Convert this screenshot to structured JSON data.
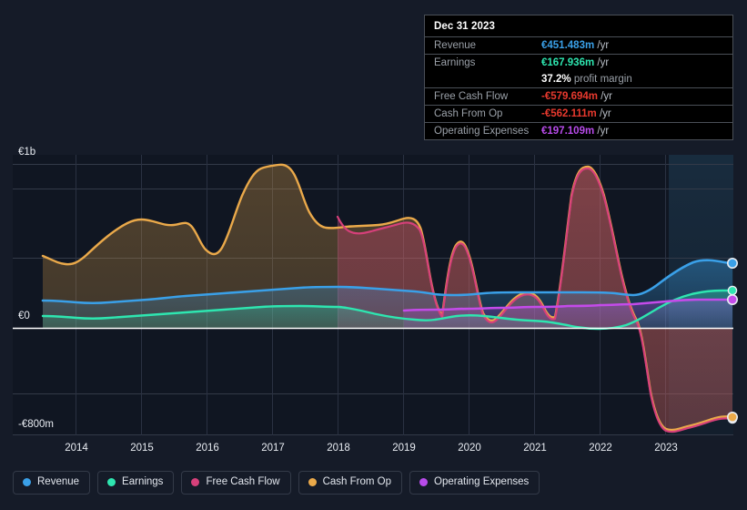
{
  "tooltip": {
    "title": "Dec 31 2023",
    "rows": [
      {
        "label": "Revenue",
        "value": "€451.483m",
        "unit": "/yr",
        "color": "#3aa0e8"
      },
      {
        "label": "Earnings",
        "value": "€167.936m",
        "unit": "/yr",
        "color": "#2ee6b0"
      },
      {
        "label": "",
        "value": "37.2%",
        "unit": "profit margin",
        "color": "#ffffff",
        "note": true
      },
      {
        "label": "Free Cash Flow",
        "value": "-€579.694m",
        "unit": "/yr",
        "color": "#e8392e"
      },
      {
        "label": "Cash From Op",
        "value": "-€562.111m",
        "unit": "/yr",
        "color": "#e8392e"
      },
      {
        "label": "Operating Expenses",
        "value": "€197.109m",
        "unit": "/yr",
        "color": "#b84bea"
      }
    ]
  },
  "legend": {
    "items": [
      {
        "label": "Revenue",
        "color": "#3aa0e8"
      },
      {
        "label": "Earnings",
        "color": "#2ee6b0"
      },
      {
        "label": "Free Cash Flow",
        "color": "#d6407a"
      },
      {
        "label": "Cash From Op",
        "color": "#eaa94a"
      },
      {
        "label": "Operating Expenses",
        "color": "#b84bea"
      }
    ]
  },
  "yaxis": {
    "labels": [
      "€1b",
      "€0",
      "-€800m"
    ]
  },
  "chart_data": {
    "type": "area",
    "title": "",
    "xlabel": "",
    "ylabel": "",
    "ylim": [
      -800,
      1000
    ],
    "ytick_values": [
      1000,
      0,
      -800
    ],
    "ytick_labels": [
      "€1b",
      "€0",
      "-€800m"
    ],
    "gridlines": [
      1000,
      660,
      320,
      0,
      -340
    ],
    "zero_line": 0,
    "grid": true,
    "legend_position": "bottom",
    "currency": "EUR",
    "units": "millions",
    "forecast_start": "2023-06",
    "x": [
      "2013.5",
      "2014",
      "2014.5",
      "2015",
      "2015.5",
      "2016",
      "2016.5",
      "2017",
      "2017.5",
      "2018",
      "2018.5",
      "2019",
      "2019.5",
      "2020",
      "2020.5",
      "2021",
      "2021.5",
      "2022",
      "2022.5",
      "2023",
      "2023.5",
      "2024"
    ],
    "categories": [
      "2014",
      "2015",
      "2016",
      "2017",
      "2018",
      "2019",
      "2020",
      "2021",
      "2022",
      "2023"
    ],
    "series": [
      {
        "name": "Revenue",
        "color": "#3aa0e8",
        "values": [
          130,
          120,
          125,
          135,
          140,
          150,
          165,
          185,
          200,
          205,
          210,
          215,
          200,
          205,
          215,
          220,
          225,
          215,
          210,
          300,
          380,
          451
        ]
      },
      {
        "name": "Earnings",
        "color": "#2ee6b0",
        "values": [
          40,
          35,
          38,
          42,
          45,
          50,
          55,
          60,
          62,
          65,
          55,
          45,
          40,
          50,
          60,
          55,
          40,
          20,
          5,
          60,
          130,
          168
        ]
      },
      {
        "name": "Free Cash Flow",
        "color": "#d6407a",
        "values": [
          null,
          null,
          null,
          null,
          null,
          null,
          null,
          null,
          null,
          700,
          180,
          140,
          330,
          70,
          55,
          200,
          140,
          960,
          120,
          -720,
          -820,
          -580
        ]
      },
      {
        "name": "Cash From Op",
        "color": "#eaa94a",
        "values": [
          430,
          400,
          420,
          520,
          570,
          540,
          460,
          690,
          860,
          700,
          185,
          150,
          340,
          80,
          60,
          210,
          150,
          965,
          130,
          -710,
          -815,
          -562
        ]
      },
      {
        "name": "Operating Expenses",
        "color": "#b84bea",
        "values": [
          null,
          null,
          null,
          null,
          null,
          null,
          null,
          null,
          null,
          null,
          90,
          100,
          105,
          110,
          112,
          115,
          118,
          120,
          125,
          150,
          180,
          197
        ]
      }
    ],
    "endpoint_markers": [
      {
        "series": "Revenue",
        "value": 451.483
      },
      {
        "series": "Operating Expenses",
        "value": 197.109
      },
      {
        "series": "Earnings",
        "value": 167.936
      },
      {
        "series": "Cash From Op",
        "value": -562.111
      },
      {
        "series": "Free Cash Flow",
        "value": -579.694
      }
    ]
  }
}
